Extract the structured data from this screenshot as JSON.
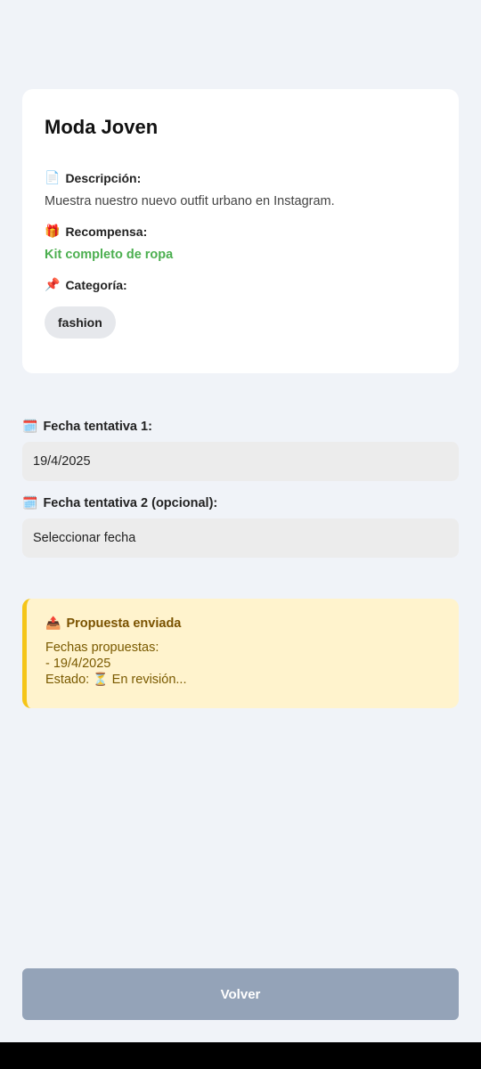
{
  "campaign": {
    "title": "Moda Joven",
    "description_label": "Descripción:",
    "description": "Muestra nuestro nuevo outfit urbano en Instagram.",
    "reward_label": "Recompensa:",
    "reward": "Kit completo de ropa",
    "category_label": "Categoría:",
    "category": "fashion",
    "icons": {
      "description": "document-icon",
      "reward": "gift-icon",
      "category": "pushpin-icon"
    }
  },
  "form": {
    "date1_label": "Fecha tentativa 1:",
    "date1_value": "19/4/2025",
    "date2_label": "Fecha tentativa 2 (opcional):",
    "date2_placeholder": "Seleccionar fecha",
    "icons": {
      "date": "calendar-icon"
    }
  },
  "proposal": {
    "title": "Propuesta enviada",
    "dates_label": "Fechas propuestas:",
    "dates": [
      "- 19/4/2025"
    ],
    "status_prefix": "Estado:",
    "status": "En revisión...",
    "icons": {
      "title": "outbox-tray-icon",
      "status": "hourglass-icon"
    }
  },
  "actions": {
    "back_label": "Volver"
  },
  "colors": {
    "background": "#f0f3f8",
    "reward_green": "#4caf50",
    "notice_bg": "#fff3cd",
    "notice_border": "#f5c518",
    "button_bg": "#94a3b8"
  }
}
